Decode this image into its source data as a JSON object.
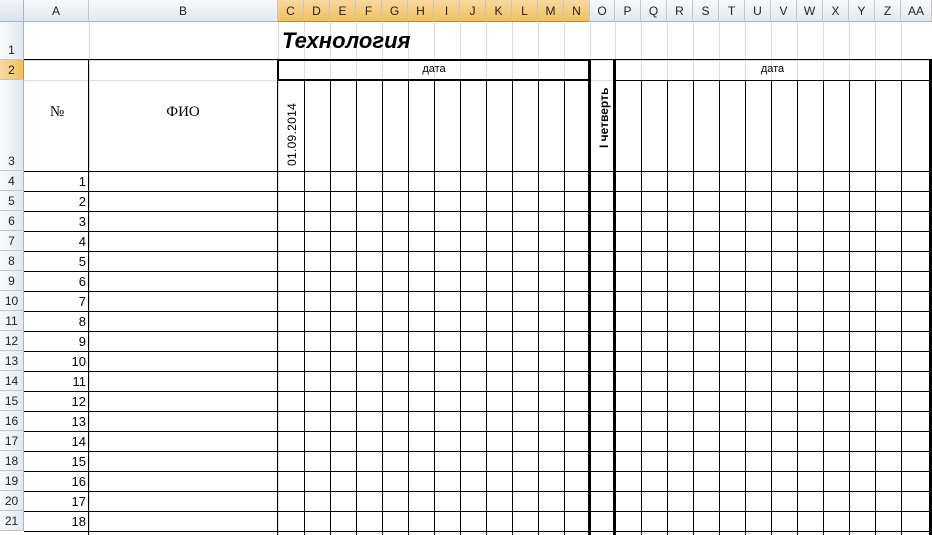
{
  "columns": [
    "A",
    "B",
    "C",
    "D",
    "E",
    "F",
    "G",
    "H",
    "I",
    "J",
    "K",
    "L",
    "M",
    "N",
    "O",
    "P",
    "Q",
    "R",
    "S",
    "T",
    "U",
    "V",
    "W",
    "X",
    "Y",
    "Z",
    "AA"
  ],
  "selected_columns": [
    "C",
    "D",
    "E",
    "F",
    "G",
    "H",
    "I",
    "J",
    "K",
    "L",
    "M",
    "N"
  ],
  "rows": [
    "1",
    "2",
    "3",
    "4",
    "5",
    "6",
    "7",
    "8",
    "9",
    "10",
    "11",
    "12",
    "13",
    "14",
    "15",
    "16",
    "17",
    "18",
    "19",
    "20",
    "21"
  ],
  "selected_rows": [
    "2"
  ],
  "cells": {
    "title": "Технология",
    "date_label_left": "дата",
    "date_label_right": "дата",
    "num_header": "№",
    "fio_header": "ФИО",
    "first_date": "01.09.2014",
    "quarter_label": "I четверть",
    "student_numbers": [
      "1",
      "2",
      "3",
      "4",
      "5",
      "6",
      "7",
      "8",
      "9",
      "10",
      "11",
      "12",
      "13",
      "14",
      "15",
      "16",
      "17",
      "18"
    ]
  }
}
